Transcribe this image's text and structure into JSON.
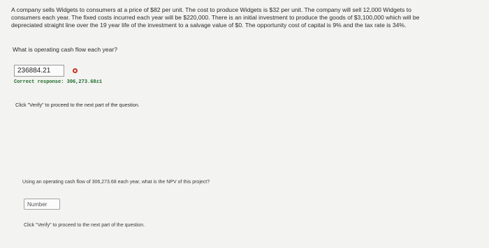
{
  "problem": {
    "line1": "A company sells Widgets to consumers at a price of $82 per unit. The cost to produce Widgets is $32 per unit. The company will sell 12,000 Widgets to",
    "line2": "consumers each year. The fixed costs incurred each year will be $220,000. There is an initial investment to produce the goods of $3,100,000 which will be",
    "line3": "depreciated straight line over the 19 year life of the investment to a salvage value of $0. The opportunity cost of capital is 9% and the tax rate is 34%."
  },
  "part1": {
    "question": "What is operating cash flow each year?",
    "answer_value": "236884.21",
    "status_icon": "incorrect-circle-icon",
    "status_color": "#c7331f",
    "correct_response": "Correct response: 306,273.68±1",
    "verify_note": "Click \"Verify\" to proceed to the next part of the question."
  },
  "part2": {
    "question": "Using an operating cash flow of 306,273.68 each year, what is the NPV of this project?",
    "input_value": "",
    "input_placeholder": "Number",
    "verify_note": "Click \"Verify\" to proceed to the next part of the question."
  }
}
